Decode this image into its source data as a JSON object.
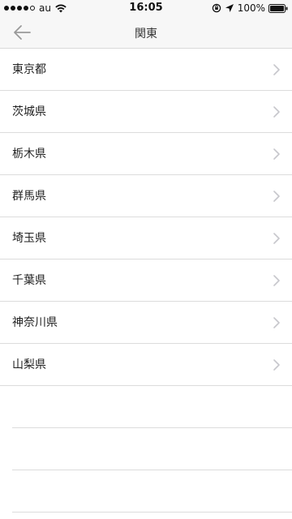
{
  "status_bar": {
    "carrier": "au",
    "time": "16:05",
    "battery": "100%",
    "icons": [
      "signal-dots",
      "wifi-icon",
      "orientation-lock-icon",
      "location-arrow-icon",
      "battery-icon"
    ]
  },
  "nav": {
    "title": "関東",
    "back_icon": "arrow-left-icon"
  },
  "list": {
    "items": [
      {
        "label": "東京都"
      },
      {
        "label": "茨城県"
      },
      {
        "label": "栃木県"
      },
      {
        "label": "群馬県"
      },
      {
        "label": "埼玉県"
      },
      {
        "label": "千葉県"
      },
      {
        "label": "神奈川県"
      },
      {
        "label": "山梨県"
      }
    ],
    "chevron_icon": "chevron-right-icon"
  },
  "colors": {
    "bar_background": "#f7f7f7",
    "separator": "#dcdcdc",
    "chevron": "#c7c7cc",
    "back_arrow": "#9a9a9a"
  }
}
